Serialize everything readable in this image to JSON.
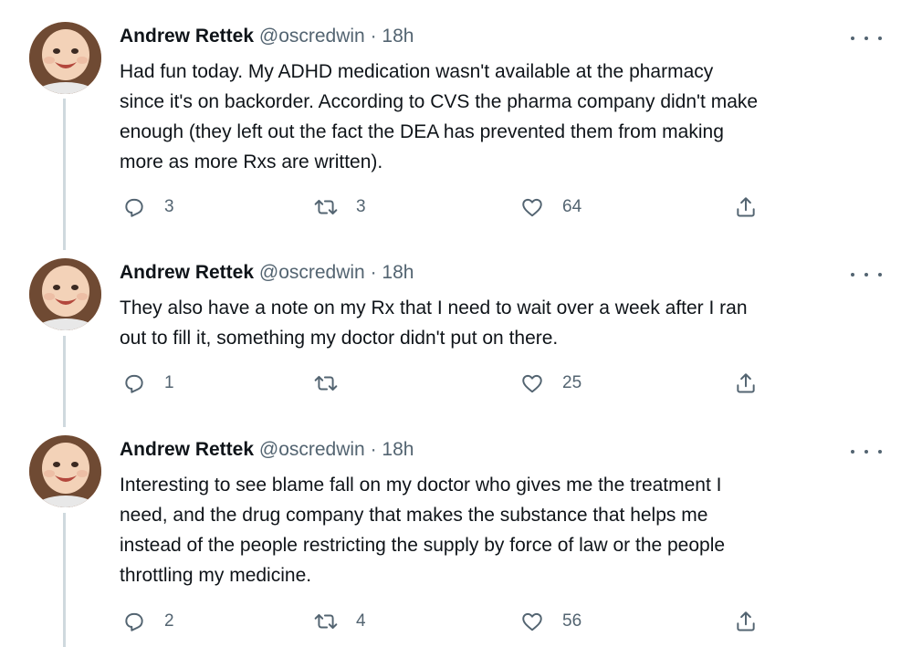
{
  "tweets": [
    {
      "author_name": "Andrew Rettek",
      "handle": "@oscredwin",
      "separator": "·",
      "time": "18h",
      "lines": [
        "Had fun today. My ADHD medication wasn't available at the pharmacy",
        "since it's on backorder. According to CVS the pharma company didn't make",
        "enough (they left out the fact the DEA has prevented them from making",
        "more as more Rxs are written)."
      ],
      "replies": "3",
      "retweets": "3",
      "likes": "64"
    },
    {
      "author_name": "Andrew Rettek",
      "handle": "@oscredwin",
      "separator": "·",
      "time": "18h",
      "lines": [
        "They also have a note on my Rx that I need to wait over a week after I ran",
        "out to fill it, something my doctor didn't put on there."
      ],
      "replies": "1",
      "retweets": "",
      "likes": "25"
    },
    {
      "author_name": "Andrew Rettek",
      "handle": "@oscredwin",
      "separator": "·",
      "time": "18h",
      "lines": [
        "Interesting to see blame fall on my doctor who gives me the treatment I",
        "need, and the drug company that makes the substance that helps me",
        "instead of the people restricting the supply by force of law or the people",
        "throttling my medicine."
      ],
      "replies": "2",
      "retweets": "4",
      "likes": "56"
    }
  ],
  "icons": {
    "reply": "speech-bubble-icon",
    "retweet": "retweet-arrows-icon",
    "like": "heart-outline-icon",
    "share": "share-upload-icon",
    "more": "more-dots-icon",
    "avatar": "baby-photo-avatar"
  },
  "colors": {
    "text": "#0f1419",
    "secondary": "#536471",
    "thread_line": "#cfd9de"
  }
}
